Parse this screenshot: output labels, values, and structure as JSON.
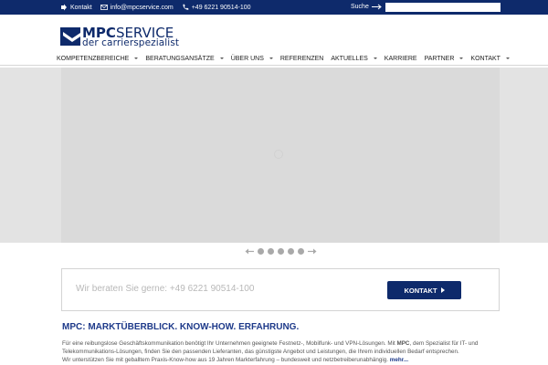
{
  "topbar": {
    "contact_label": "Kontakt",
    "email": "info@mpcservice.com",
    "phone": "+49 6221 90514-100",
    "search_label": "Suche",
    "search_value": ""
  },
  "logo": {
    "title_bold": "MPC",
    "title_thin": "SERVICE",
    "subtitle": "der carrierspezialist"
  },
  "nav": {
    "items": [
      {
        "label": "KOMPETENZBEREICHE",
        "has_dropdown": true
      },
      {
        "label": "BERATUNGSANSÄTZE",
        "has_dropdown": true
      },
      {
        "label": "ÜBER UNS",
        "has_dropdown": true
      },
      {
        "label": "REFERENZEN",
        "has_dropdown": false
      },
      {
        "label": "AKTUELLES",
        "has_dropdown": true
      },
      {
        "label": "KARRIERE",
        "has_dropdown": false
      },
      {
        "label": "PARTNER",
        "has_dropdown": true
      },
      {
        "label": "KONTAKT",
        "has_dropdown": true
      }
    ]
  },
  "slider": {
    "dot_count": 5
  },
  "contact_box": {
    "text": "Wir beraten Sie gerne: +49 6221 90514-100",
    "button_label": "KONTAKT"
  },
  "intro": {
    "title": "MPC: MARKTÜBERBLICK. KNOW-HOW. ERFAHRUNG.",
    "line1_a": "Für eine reibungslose Geschäftskommunikation benötigt Ihr Unternehmen geeignete Festnetz-, Mobilfunk- und VPN-Lösungen. Mit ",
    "line1_bold": "MPC",
    "line1_b": ", dem Spezialist für IT- und",
    "line2": "Telekommunikations-Lösungen, finden Sie den passenden Lieferanten, das günstigste Angebot und Leistungen, die Ihrem individuellen Bedarf entsprechen.",
    "line3": "Wir unterstützen Sie mit geballtem Praxis-Know-how aus 19 Jahren Markterfahrung – bundesweit und netzbetreiberunabhängig.",
    "more_label": "mehr..."
  },
  "colors": {
    "brand": "#0e2a6b",
    "heading": "#1e3a8a",
    "muted_text": "#b8b8b8"
  }
}
